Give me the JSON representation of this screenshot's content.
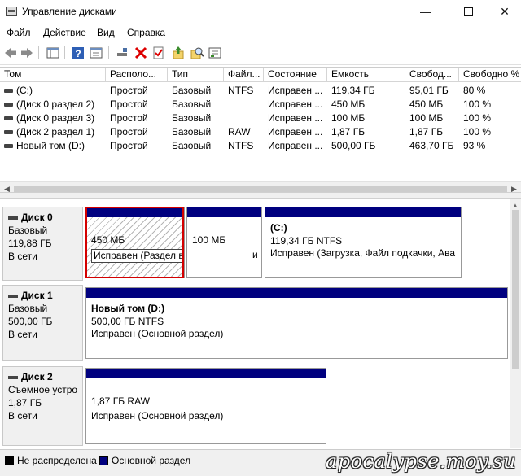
{
  "window": {
    "title": "Управление дисками",
    "minimize": "—",
    "close": "✕"
  },
  "menu": [
    "Файл",
    "Действие",
    "Вид",
    "Справка"
  ],
  "toolbar": {
    "icons": [
      "back-icon",
      "forward-icon",
      "show-hide-tree-icon",
      "help-icon",
      "properties-icon",
      "connect-icon",
      "delete-icon",
      "check-icon",
      "export-icon",
      "search-icon",
      "settings-icon"
    ]
  },
  "volumes": {
    "columns": [
      "Том",
      "Располо...",
      "Тип",
      "Файл...",
      "Состояние",
      "Емкость",
      "Свобод...",
      "Свободно %"
    ],
    "rows": [
      [
        "(C:)",
        "Простой",
        "Базовый",
        "NTFS",
        "Исправен ...",
        "119,34 ГБ",
        "95,01 ГБ",
        "80 %"
      ],
      [
        "(Диск 0 раздел 2)",
        "Простой",
        "Базовый",
        "",
        "Исправен ...",
        "450 МБ",
        "450 МБ",
        "100 %"
      ],
      [
        "(Диск 0 раздел 3)",
        "Простой",
        "Базовый",
        "",
        "Исправен ...",
        "100 МБ",
        "100 МБ",
        "100 %"
      ],
      [
        "(Диск 2 раздел 1)",
        "Простой",
        "Базовый",
        "RAW",
        "Исправен ...",
        "1,87 ГБ",
        "1,87 ГБ",
        "100 %"
      ],
      [
        "Новый том (D:)",
        "Простой",
        "Базовый",
        "NTFS",
        "Исправен ...",
        "500,00 ГБ",
        "463,70 ГБ",
        "93 %"
      ]
    ]
  },
  "disks": [
    {
      "name": "Диск 0",
      "type": "Базовый",
      "size": "119,88 ГБ",
      "status": "В сети",
      "partitions": [
        {
          "name": "",
          "size": "450 МБ",
          "status": "Исправен (Раздел восстановления)"
        },
        {
          "name": "",
          "size": "100 МБ",
          "status": "и"
        },
        {
          "name": "(C:)",
          "size": "119,34 ГБ NTFS",
          "status": "Исправен (Загрузка, Файл подкачки, Ава"
        }
      ]
    },
    {
      "name": "Диск 1",
      "type": "Базовый",
      "size": "500,00 ГБ",
      "status": "В сети",
      "partitions": [
        {
          "name": "Новый том  (D:)",
          "size": "500,00 ГБ NTFS",
          "status": "Исправен (Основной раздел)"
        }
      ]
    },
    {
      "name": "Диск 2",
      "type": "Съемное устро",
      "size": "1,87 ГБ",
      "status": "В сети",
      "partitions": [
        {
          "name": "",
          "size": "1,87 ГБ RAW",
          "status": "Исправен (Основной раздел)"
        }
      ]
    }
  ],
  "legend": {
    "unallocated": "Не распределена",
    "primary": "Основной раздел",
    "unallocated_color": "#000000",
    "primary_color": "#00007f"
  },
  "watermark": "apocalypse.moy.su",
  "colors": {
    "partition_bar": "#00007f",
    "selection": "#d40000"
  }
}
